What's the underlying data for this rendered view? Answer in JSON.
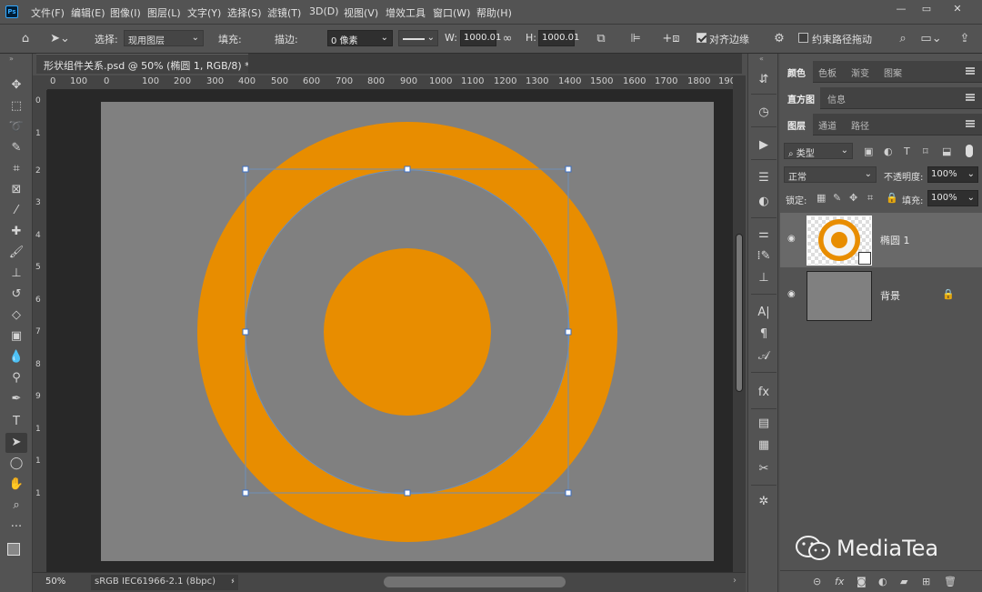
{
  "app": {
    "logo": "Ps"
  },
  "menu": [
    "文件(F)",
    "编辑(E)",
    "图像(I)",
    "图层(L)",
    "文字(Y)",
    "选择(S)",
    "滤镜(T)",
    "3D(D)",
    "视图(V)",
    "增效工具",
    "窗口(W)",
    "帮助(H)"
  ],
  "window_controls": [
    "minimize-icon",
    "restore-icon",
    "close-icon"
  ],
  "options": {
    "select_label": "选择:",
    "select_value": "现用图层",
    "fill_label": "填充:",
    "fill_color": "#e88d00",
    "stroke_label": "描边:",
    "stroke_width": "0 像素",
    "w_label": "W:",
    "w_value": "1000.01",
    "h_label": "H:",
    "h_value": "1000.01",
    "align_edges_label": "对齐边缘",
    "align_edges_checked": true,
    "constrain_label": "约束路径拖动",
    "constrain_checked": false
  },
  "document": {
    "tab_title": "形状组件关系.psd @ 50% (椭圆 1, RGB/8) *",
    "close": "×"
  },
  "ruler": {
    "h_ticks": [
      "0",
      "100",
      "0",
      "100",
      "200",
      "300",
      "400",
      "500",
      "600",
      "700",
      "800",
      "900",
      "1000",
      "1100",
      "1200",
      "1300",
      "1400",
      "1500",
      "1600",
      "1700",
      "1800",
      "190"
    ],
    "v_ticks": [
      "0",
      "1",
      "2",
      "3",
      "4",
      "5",
      "6",
      "7",
      "8",
      "9",
      "1",
      "1",
      "1"
    ]
  },
  "canvas": {
    "background": "#808080",
    "shape_color": "#e88d00"
  },
  "status": {
    "zoom": "50%",
    "profile": "sRGB IEC61966-2.1 (8bpc)"
  },
  "panels": {
    "tabs_row1": [
      "颜色",
      "色板",
      "渐变",
      "图案"
    ],
    "tabs_row2": [
      "直方图",
      "信息"
    ],
    "tabs_row3": [
      "图层",
      "通道",
      "路径"
    ],
    "filter_kind": "类型",
    "blend_mode": "正常",
    "opacity_label": "不透明度:",
    "opacity_value": "100%",
    "lock_label": "锁定:",
    "fill_label": "填充:",
    "fill_value": "100%",
    "layers": [
      {
        "name": "椭圆 1",
        "selected": true
      },
      {
        "name": "背景",
        "selected": false
      }
    ]
  },
  "watermark": "MediaTea"
}
